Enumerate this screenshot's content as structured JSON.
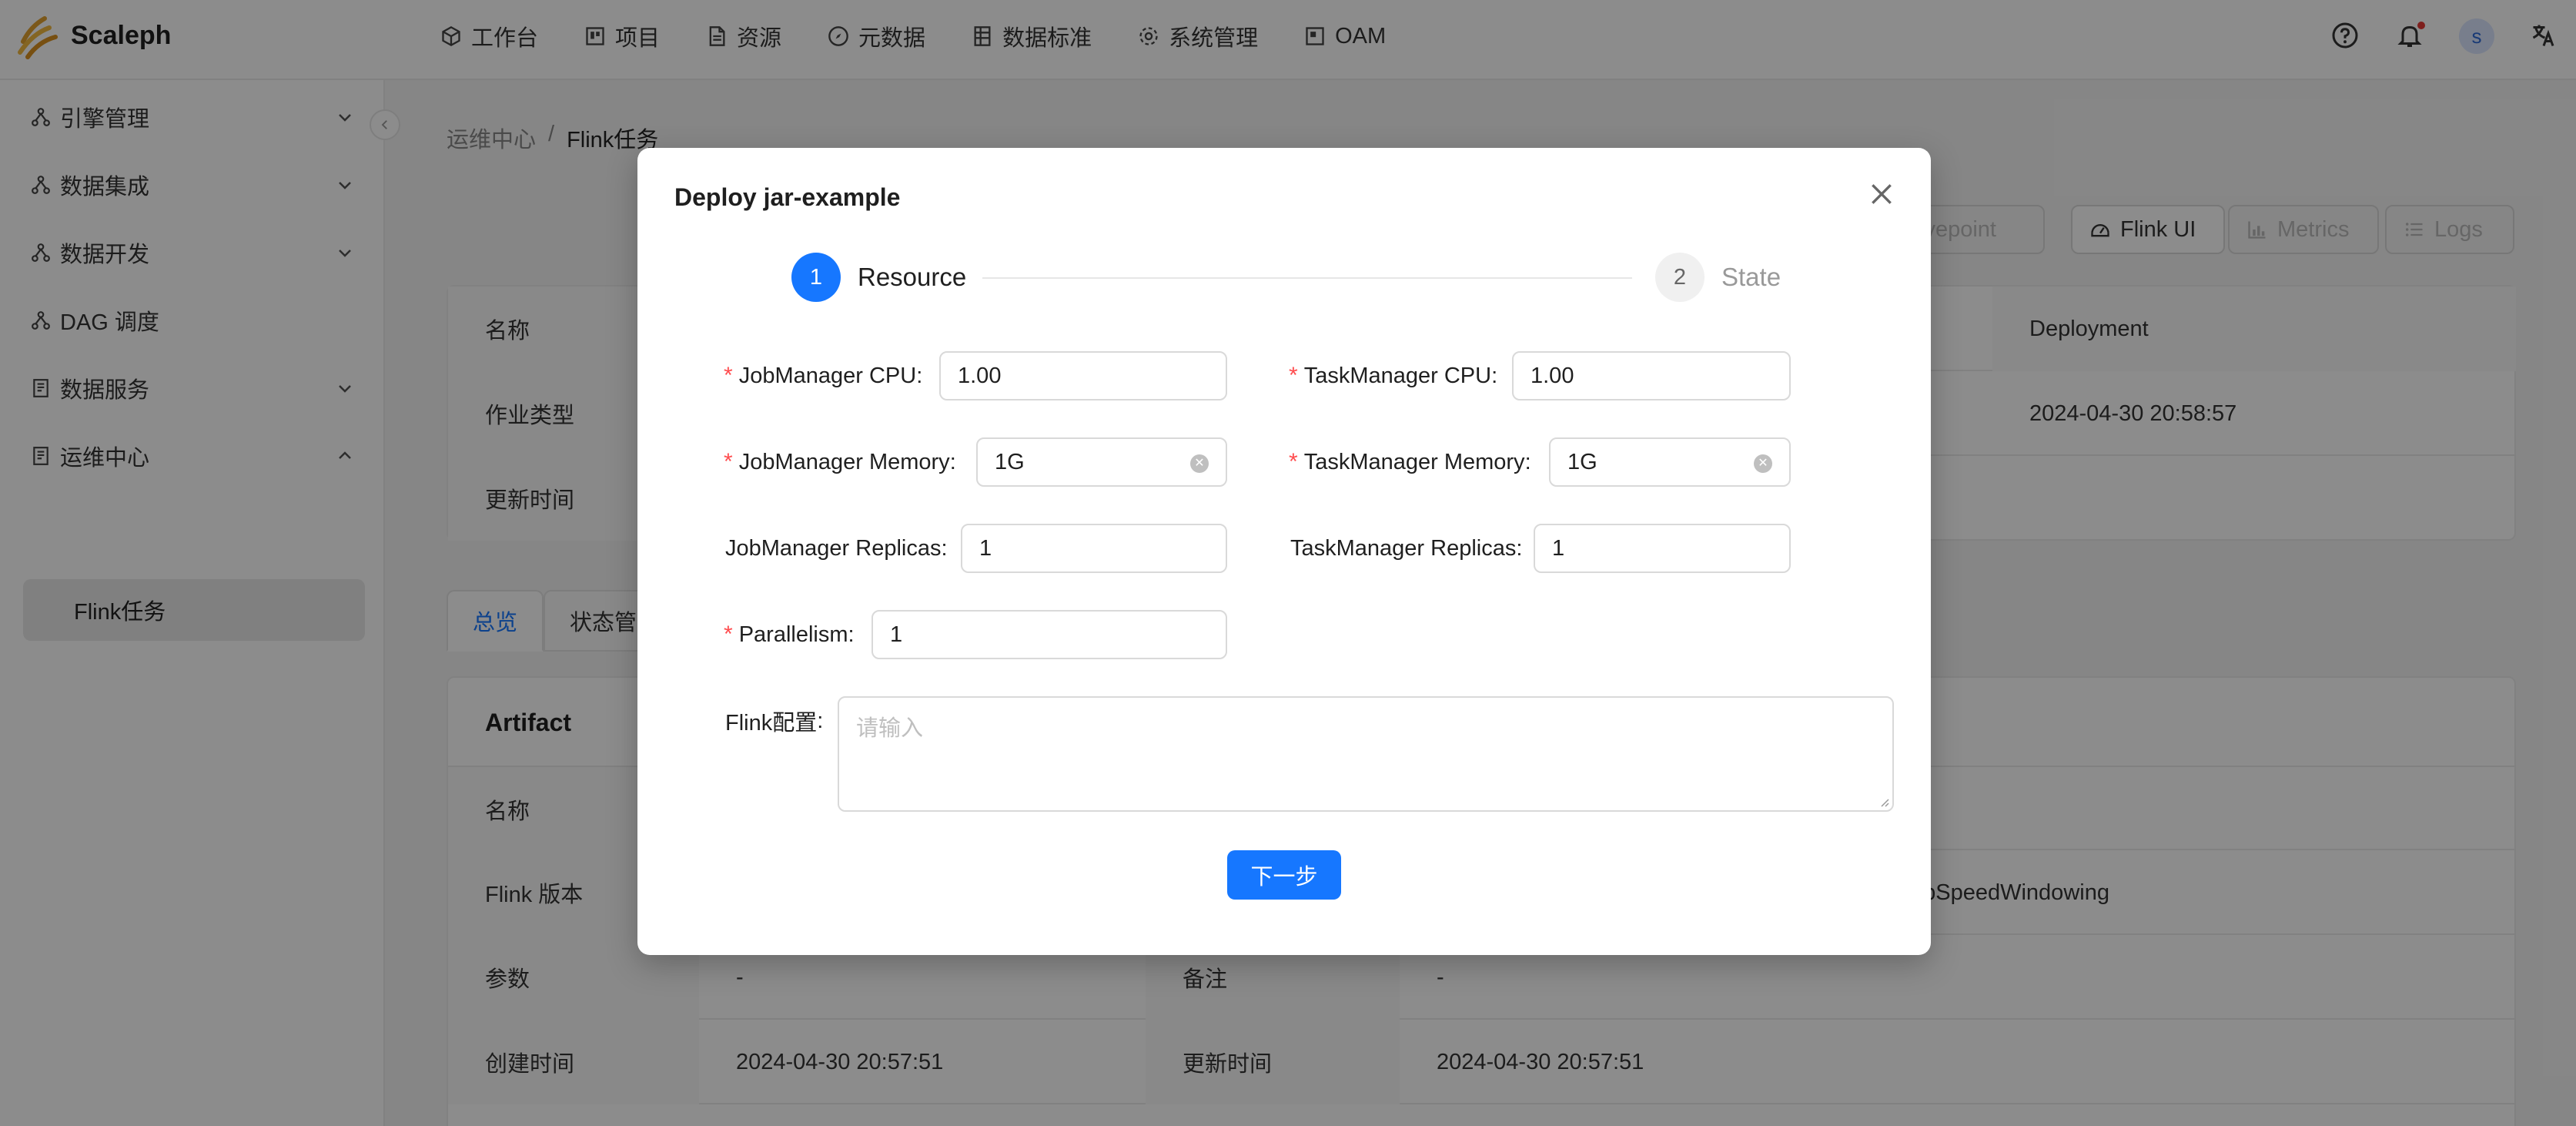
{
  "app": {
    "name": "Scaleph"
  },
  "topnav": [
    {
      "label": "工作台",
      "icon": "cube-icon"
    },
    {
      "label": "项目",
      "icon": "project-icon"
    },
    {
      "label": "资源",
      "icon": "file-icon"
    },
    {
      "label": "元数据",
      "icon": "compass-icon"
    },
    {
      "label": "数据标准",
      "icon": "table-icon"
    },
    {
      "label": "系统管理",
      "icon": "gear-icon"
    },
    {
      "label": "OAM",
      "icon": "window-icon"
    }
  ],
  "header_right": {
    "avatar_letter": "s"
  },
  "sidebar": {
    "items": [
      {
        "label": "引擎管理",
        "expanded": false
      },
      {
        "label": "数据集成",
        "expanded": false
      },
      {
        "label": "数据开发",
        "expanded": false
      },
      {
        "label": "DAG 调度"
      },
      {
        "label": "数据服务",
        "expanded": false
      },
      {
        "label": "运维中心",
        "expanded": true
      }
    ],
    "sub_item": "Flink任务"
  },
  "breadcrumb": {
    "parent": "运维中心",
    "separator": "/",
    "current": "Flink任务"
  },
  "toolbar": {
    "savepoint": "Savepoint",
    "flink_ui": "Flink UI",
    "metrics": "Metrics",
    "logs": "Logs"
  },
  "info_table": {
    "rows": [
      {
        "label": "名称",
        "right_label": "Deployment"
      },
      {
        "label": "作业类型",
        "right_value": "2024-04-30 20:58:57"
      },
      {
        "label": "更新时间"
      }
    ]
  },
  "tabs": [
    "总览",
    "状态管"
  ],
  "artifact": {
    "title": "Artifact",
    "rows": [
      {
        "label": "名称"
      },
      {
        "label": "Flink 版本",
        "value_right": "opSpeedWindowing"
      },
      {
        "label": "参数",
        "value": "-",
        "label2": "备注",
        "value2": "-"
      },
      {
        "label": "创建时间",
        "value": "2024-04-30 20:57:51",
        "label2": "更新时间",
        "value2": "2024-04-30 20:57:51"
      }
    ]
  },
  "modal": {
    "title": "Deploy jar-example",
    "steps": [
      {
        "number": "1",
        "label": "Resource",
        "status": "active"
      },
      {
        "number": "2",
        "label": "State",
        "status": "wait"
      }
    ],
    "fields": {
      "jm_cpu": {
        "label": "JobManager CPU",
        "value": "1.00",
        "required": true
      },
      "tm_cpu": {
        "label": "TaskManager CPU",
        "value": "1.00",
        "required": true
      },
      "jm_memory": {
        "label": "JobManager Memory",
        "value": "1G",
        "required": true
      },
      "tm_memory": {
        "label": "TaskManager Memory",
        "value": "1G",
        "required": true
      },
      "jm_replicas": {
        "label": "JobManager Replicas",
        "value": "1",
        "required": false
      },
      "tm_replicas": {
        "label": "TaskManager Replicas",
        "value": "1",
        "required": false
      },
      "parallelism": {
        "label": "Parallelism",
        "value": "1",
        "required": true
      },
      "flink_config": {
        "label": "Flink配置",
        "placeholder": "请输入"
      }
    },
    "label_colon": ":",
    "required_mark": "*",
    "next_button": "下一步"
  },
  "colors": {
    "primary": "#1677ff",
    "required": "#ff4d4f",
    "mask": "rgba(0,0,0,0.45)"
  }
}
